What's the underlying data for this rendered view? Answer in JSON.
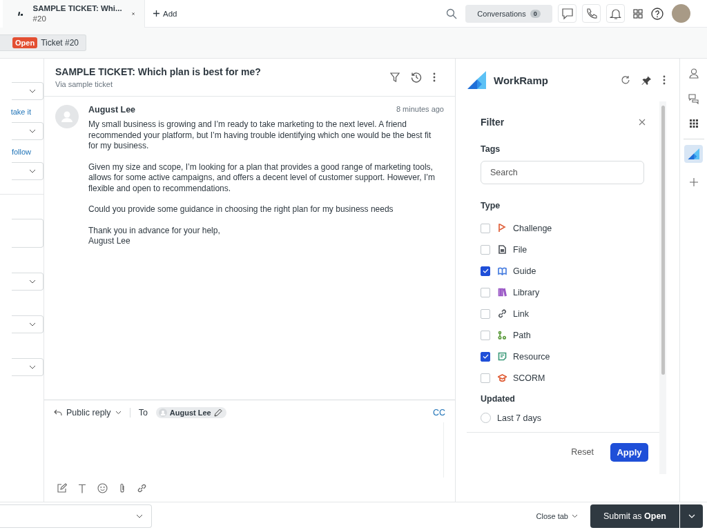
{
  "top_tab": {
    "title": "SAMPLE TICKET: Whi...",
    "subtitle": "#20"
  },
  "add_label": "Add",
  "conversations": {
    "label": "Conversations",
    "count": "0"
  },
  "subbar": {
    "status": "Open",
    "ticket": "Ticket #20"
  },
  "side_links": [
    "take it",
    "follow"
  ],
  "ticket": {
    "title": "SAMPLE TICKET: Which plan is best for me?",
    "via": "Via sample ticket"
  },
  "message": {
    "author": "August Lee",
    "time": "8 minutes ago",
    "paragraphs": [
      "My small business is growing and I’m ready to take marketing to the next level. A friend recommended your platform, but I’m having trouble identifying which one would be the best fit for my business.",
      "Given my size and scope, I’m looking for a plan that provides a good range of marketing tools, allows for some active campaigns, and offers a decent level of customer support. However, I’m flexible and open to recommendations.",
      "Could you provide some guidance in choosing the right plan for my business needs",
      "Thank you in advance for your help,\nAugust Lee"
    ]
  },
  "reply": {
    "mode": "Public reply",
    "to_label": "To",
    "recipient": "August Lee",
    "cc": "CC"
  },
  "app": {
    "name": "WorkRamp"
  },
  "filter": {
    "title": "Filter",
    "tags_label": "Tags",
    "search_placeholder": "Search",
    "type_label": "Type",
    "types": [
      {
        "label": "Challenge",
        "checked": false,
        "color": "#e0603a"
      },
      {
        "label": "File",
        "checked": false,
        "color": "#555a60"
      },
      {
        "label": "Guide",
        "checked": true,
        "color": "#4a7fe0"
      },
      {
        "label": "Library",
        "checked": false,
        "color": "#9b59c6"
      },
      {
        "label": "Link",
        "checked": false,
        "color": "#555a60"
      },
      {
        "label": "Path",
        "checked": false,
        "color": "#5a9a3a"
      },
      {
        "label": "Resource",
        "checked": true,
        "color": "#3d9a7a"
      },
      {
        "label": "SCORM",
        "checked": false,
        "color": "#e0603a"
      }
    ],
    "updated_label": "Updated",
    "updated_options": [
      {
        "label": "Last 7 days",
        "selected": false
      }
    ],
    "reset": "Reset",
    "apply": "Apply"
  },
  "footer": {
    "close_tab": "Close tab",
    "submit": "Submit as",
    "submit_status": "Open"
  }
}
